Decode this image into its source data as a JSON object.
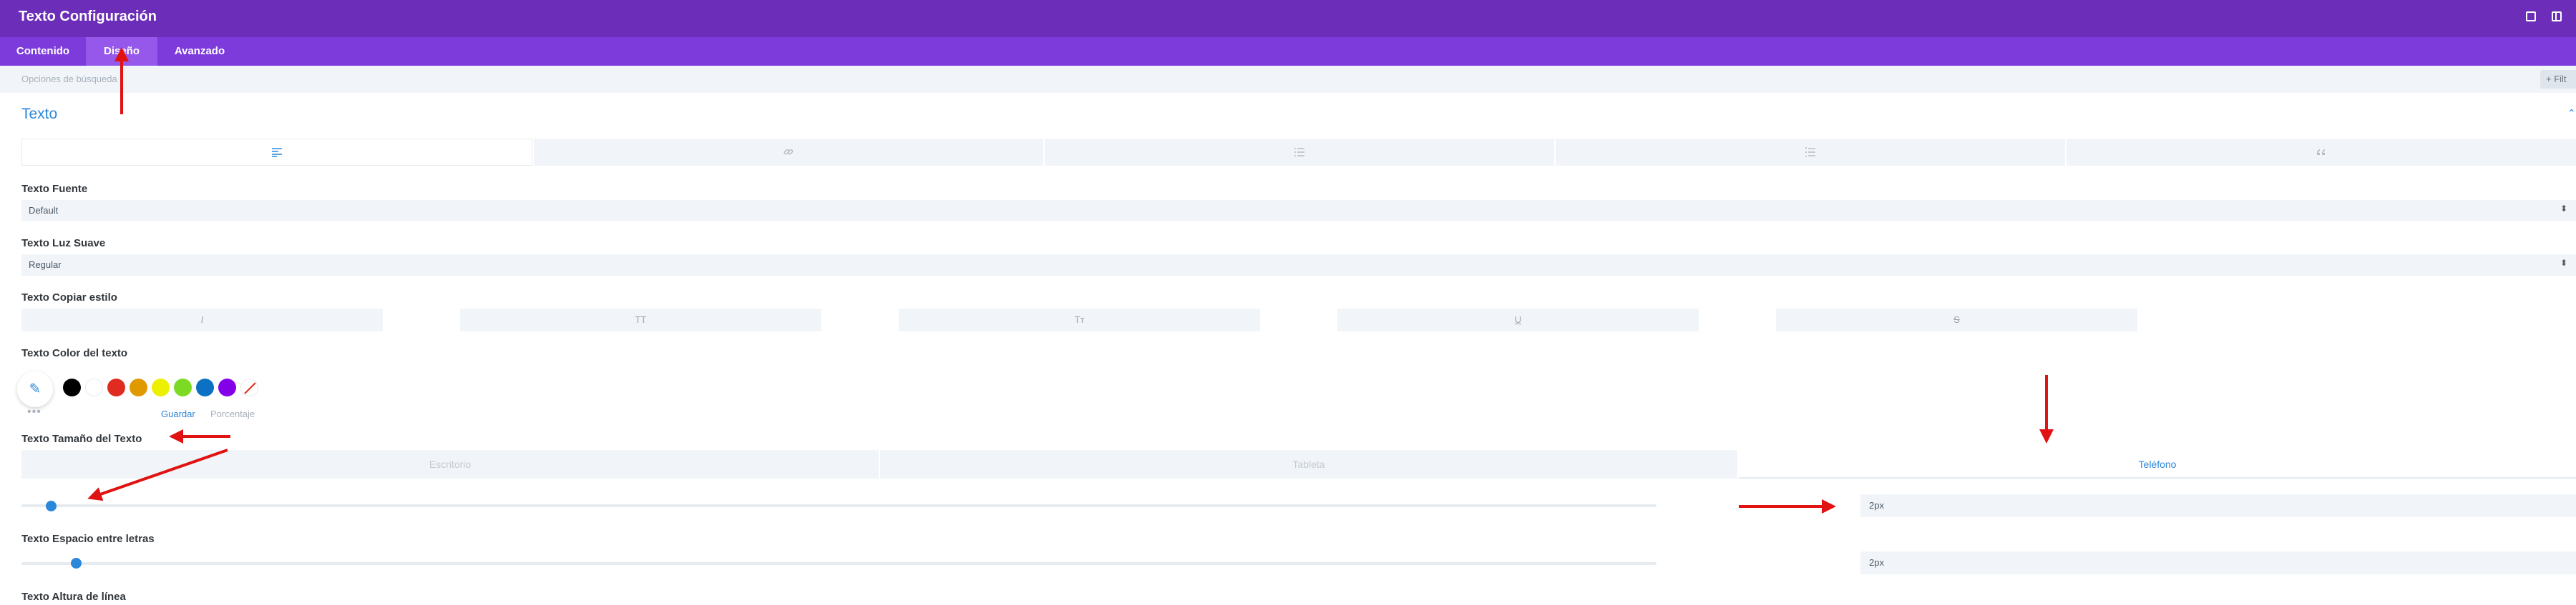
{
  "window": {
    "title": "Texto Configuración"
  },
  "tabs": [
    {
      "label": "Contenido"
    },
    {
      "label": "Diseño"
    },
    {
      "label": "Avanzado"
    }
  ],
  "search": {
    "placeholder": "Opciones de búsqueda",
    "filter_label": "+ Filt"
  },
  "section": {
    "title": "Texto"
  },
  "alignment": {
    "icons": [
      "align-left-icon",
      "link-icon",
      "list-icon",
      "ordered-list-icon",
      "quote-icon"
    ]
  },
  "fields": {
    "font_label": "Texto Fuente",
    "font_value": "Default",
    "weight_label": "Texto Luz Suave",
    "weight_value": "Regular",
    "style_label": "Texto Copiar estilo",
    "styles": [
      "I",
      "TT",
      "Tт",
      "U",
      "S"
    ],
    "color_label": "Texto Color del texto",
    "size_label": "Texto Tamaño del Texto",
    "spacing_label": "Texto Espacio entre letras",
    "lineheight_label": "Texto Altura de línea"
  },
  "colors": {
    "swatches": [
      "#000000",
      "#ffffff",
      "#e02b20",
      "#e09900",
      "#edf000",
      "#7cda24",
      "#0c71c3",
      "#8300e9"
    ],
    "accent": "#2b87da",
    "header": "#6c2eb9",
    "tabs": "#7d3bdc",
    "annotation": "#e01212"
  },
  "color_actions": {
    "more": "•••",
    "save": "Guardar",
    "percent": "Porcentaje"
  },
  "devices": [
    {
      "label": "Escritorio"
    },
    {
      "label": "Tableta"
    },
    {
      "label": "Teléfono"
    }
  ],
  "size": {
    "value": "2px",
    "slider_fraction": 0.015
  },
  "spacing": {
    "value": "2px",
    "slider_fraction": 0.03
  }
}
